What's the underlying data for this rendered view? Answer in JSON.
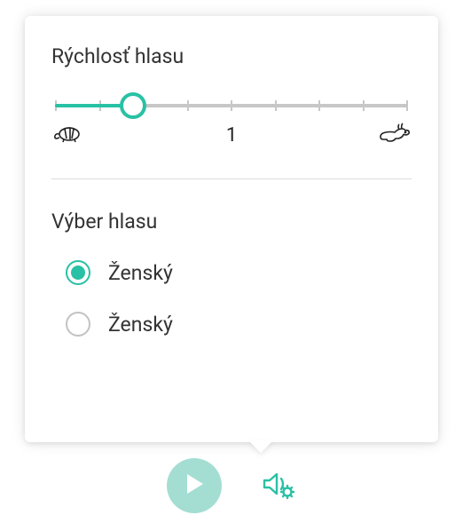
{
  "speed": {
    "title": "Rýchlosť hlasu",
    "center_label": "1",
    "value_percent": 22
  },
  "voice": {
    "title": "Výber hlasu",
    "options": [
      {
        "label": "Ženský",
        "selected": true
      },
      {
        "label": "Ženský",
        "selected": false
      }
    ]
  },
  "colors": {
    "accent": "#29c1a5",
    "play_bg": "#a4ded3"
  }
}
